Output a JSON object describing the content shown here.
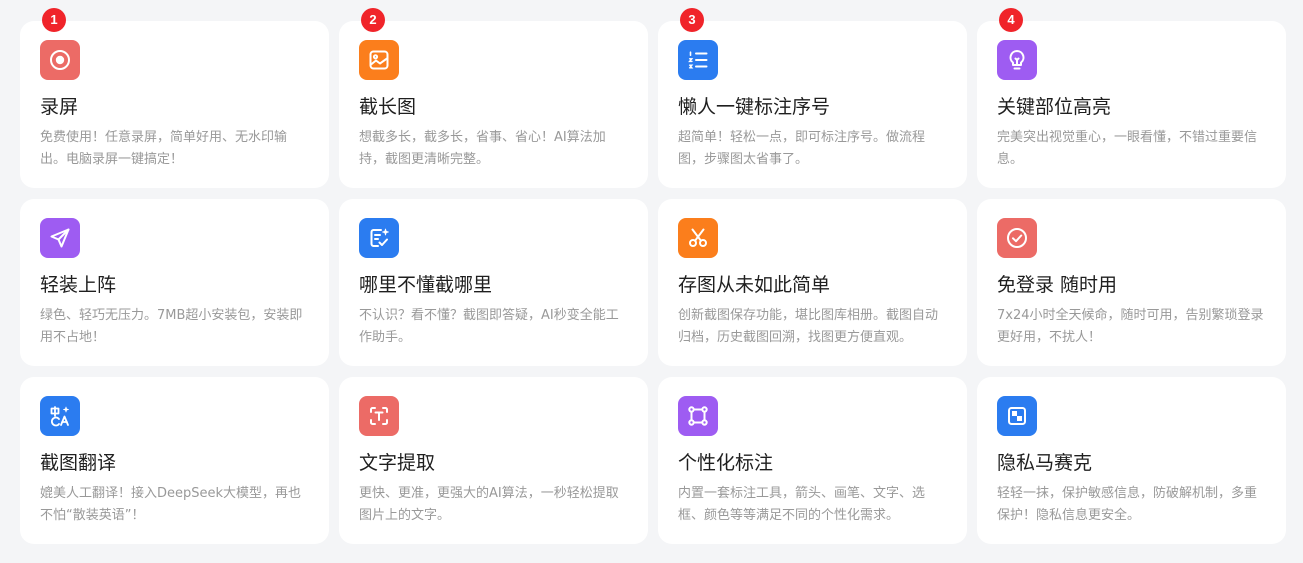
{
  "features": [
    {
      "title": "录屏",
      "desc": "免费使用！任意录屏，简单好用、无水印输出。电脑录屏一键搞定！",
      "badge": "1",
      "icon": "record-icon",
      "color": "#ec6b66"
    },
    {
      "title": "截长图",
      "desc": "想截多长，截多长，省事、省心！AI算法加持，截图更清晰完整。",
      "badge": "2",
      "icon": "long-screenshot-icon",
      "color": "#fb7e1c"
    },
    {
      "title": "懒人一键标注序号",
      "desc": "超简单！轻松一点，即可标注序号。做流程图，步骤图太省事了。",
      "badge": "3",
      "icon": "numbered-list-icon",
      "color": "#2b7cf0"
    },
    {
      "title": "关键部位高亮",
      "desc": "完美突出视觉重心，一眼看懂，不错过重要信息。",
      "badge": "4",
      "icon": "lightbulb-icon",
      "color": "#9e5cf2"
    },
    {
      "title": "轻装上阵",
      "desc": "绿色、轻巧无压力。7MB超小安装包，安装即用不占地！",
      "badge": "",
      "icon": "paper-plane-icon",
      "color": "#9e5cf2"
    },
    {
      "title": "哪里不懂截哪里",
      "desc": "不认识？看不懂？截图即答疑，AI秒变全能工作助手。",
      "badge": "",
      "icon": "ai-note-icon",
      "color": "#2b7cf0"
    },
    {
      "title": "存图从未如此简单",
      "desc": "创新截图保存功能，堪比图库相册。截图自动归档，历史截图回溯，找图更方便直观。",
      "badge": "",
      "icon": "scissors-icon",
      "color": "#fb7e1c"
    },
    {
      "title": "免登录 随时用",
      "desc": "7x24小时全天候命，随时可用，告别繁琐登录更好用，不扰人！",
      "badge": "",
      "icon": "check-circle-icon",
      "color": "#ec6b66"
    },
    {
      "title": "截图翻译",
      "desc": "媲美人工翻译！接入DeepSeek大模型，再也不怕“散装英语”！",
      "badge": "",
      "icon": "translate-icon",
      "color": "#2b7cf0"
    },
    {
      "title": "文字提取",
      "desc": "更快、更准，更强大的AI算法，一秒轻松提取图片上的文字。",
      "badge": "",
      "icon": "text-extract-icon",
      "color": "#ec6b66"
    },
    {
      "title": "个性化标注",
      "desc": "内置一套标注工具，箭头、画笔、文字、选框、颜色等等满足不同的个性化需求。",
      "badge": "",
      "icon": "selection-box-icon",
      "color": "#9e5cf2"
    },
    {
      "title": "隐私马赛克",
      "desc": "轻轻一抹，保护敏感信息，防破解机制，多重保护！隐私信息更安全。",
      "badge": "",
      "icon": "mosaic-icon",
      "color": "#2b7cf0"
    }
  ]
}
